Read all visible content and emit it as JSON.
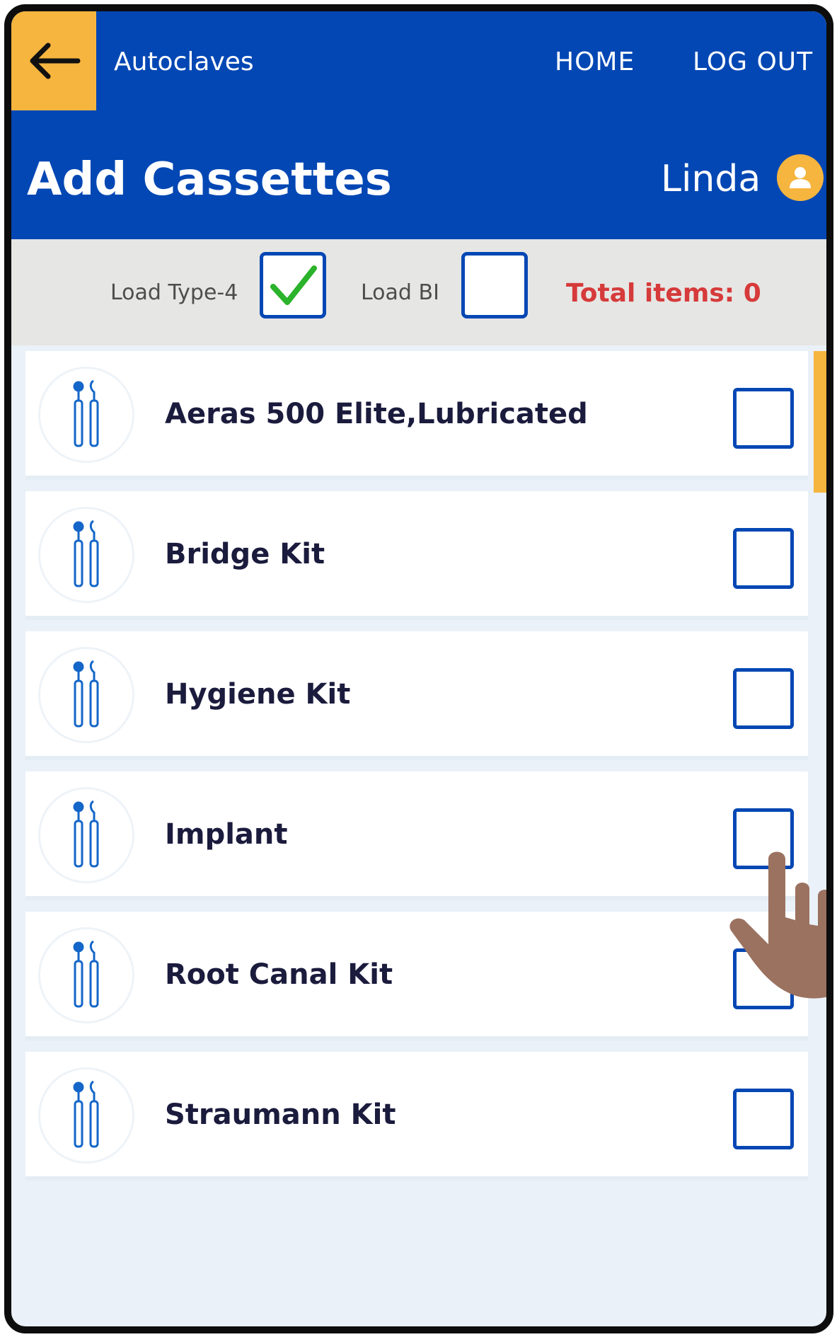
{
  "header": {
    "app_title": "Autoclaves",
    "nav": {
      "home": "HOME",
      "logout": "LOG OUT"
    },
    "page_title": "Add Cassettes",
    "user_name": "Linda",
    "colors": {
      "primary": "#0347b4",
      "accent": "#f6b53f"
    }
  },
  "options": {
    "load_type4_label": "Load Type-4",
    "load_type4_checked": true,
    "load_bi_label": "Load BI",
    "load_bi_checked": false,
    "total_items": "Total items: 0",
    "total_items_color": "#d63a3a"
  },
  "cassettes": [
    {
      "label": "Aeras 500 Elite,Lubricated",
      "checked": false,
      "icon": "dental-instruments-icon"
    },
    {
      "label": "Bridge Kit",
      "checked": false,
      "icon": "dental-instruments-icon"
    },
    {
      "label": "Hygiene Kit",
      "checked": false,
      "icon": "dental-instruments-icon"
    },
    {
      "label": "Implant",
      "checked": false,
      "icon": "dental-instruments-icon"
    },
    {
      "label": "Root Canal Kit",
      "checked": false,
      "icon": "dental-instruments-icon"
    },
    {
      "label": "Straumann Kit",
      "checked": false,
      "icon": "dental-instruments-icon"
    }
  ]
}
